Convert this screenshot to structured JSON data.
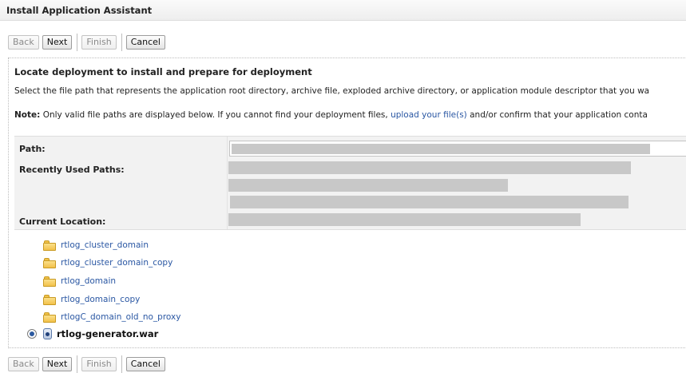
{
  "window": {
    "title": "Install Application Assistant"
  },
  "buttons": {
    "back": "Back",
    "next": "Next",
    "finish": "Finish",
    "cancel": "Cancel"
  },
  "page": {
    "heading": "Locate deployment to install and prepare for deployment",
    "description": "Select the file path that represents the application root directory, archive file, exploded archive directory, or application module descriptor that you wa",
    "note_label": "Note:",
    "note_pre": "Only valid file paths are displayed below. If you cannot find your deployment files,",
    "note_link": "upload your file(s)",
    "note_post": "and/or confirm that your application conta"
  },
  "form": {
    "path_label": "Path:",
    "recent_label": "Recently Used Paths:",
    "current_label": "Current Location:"
  },
  "tree": {
    "folders": [
      "rtlog_cluster_domain",
      "rtlog_cluster_domain_copy",
      "rtlog_domain",
      "rtlog_domain_copy",
      "rtlogC_domain_old_no_proxy"
    ],
    "selected_file": "rtlog-generator.war",
    "folder_icon": "folder-icon",
    "file_icon": "war-archive-icon"
  },
  "colors": {
    "link": "#2a57a3",
    "redacted": "#c8c8c8"
  }
}
